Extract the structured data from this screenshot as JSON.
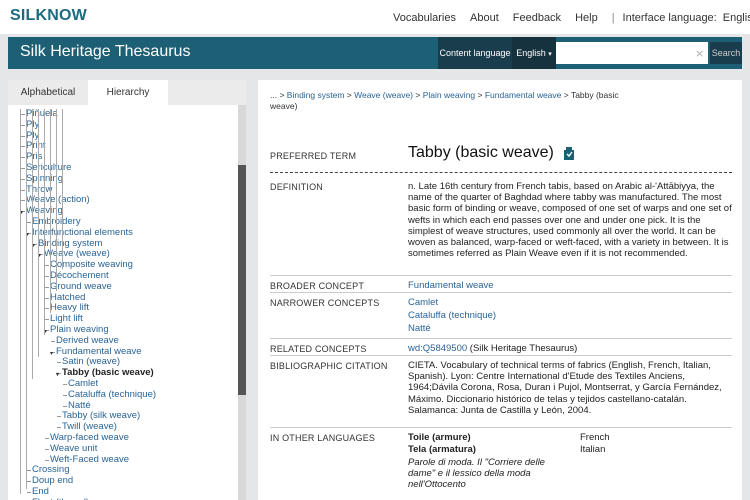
{
  "topnav": {
    "logo": "SILKNOW",
    "links": [
      "Vocabularies",
      "About",
      "Feedback",
      "Help"
    ],
    "interface_language_label": "Interface language:",
    "interface_language_value": "English"
  },
  "header": {
    "title": "Silk Heritage Thesaurus",
    "content_language_label": "Content language",
    "content_language_value": "English",
    "search_placeholder": "",
    "search_button": "Search"
  },
  "tabs": [
    "Alphabetical",
    "Hierarchy"
  ],
  "tree": [
    {
      "label": "Piñuela",
      "level": 2
    },
    {
      "label": "Ply",
      "level": 2
    },
    {
      "label": "Ply",
      "level": 2
    },
    {
      "label": "Print",
      "level": 2
    },
    {
      "label": "Pris",
      "level": 2
    },
    {
      "label": "Sericulture",
      "level": 2
    },
    {
      "label": "Spinning",
      "level": 2
    },
    {
      "label": "Throw",
      "level": 2
    },
    {
      "label": "Weave (action)",
      "level": 2
    },
    {
      "label": "Weaving",
      "level": 2,
      "expanded": true
    },
    {
      "label": "Embroidery",
      "level": 3
    },
    {
      "label": "Interfunctional elements",
      "level": 3,
      "expanded": true
    },
    {
      "label": "Binding system",
      "level": 4,
      "expanded": true
    },
    {
      "label": "Weave (weave)",
      "level": 5,
      "expanded": true
    },
    {
      "label": "Composite weaving",
      "level": 6
    },
    {
      "label": "Décochement",
      "level": 6
    },
    {
      "label": "Ground weave",
      "level": 6
    },
    {
      "label": "Hatched",
      "level": 6
    },
    {
      "label": "Heavy lift",
      "level": 6
    },
    {
      "label": "Light lift",
      "level": 6
    },
    {
      "label": "Plain weaving",
      "level": 6,
      "expanded": true
    },
    {
      "label": "Derived weave",
      "level": 7
    },
    {
      "label": "Fundamental weave",
      "level": 7,
      "expanded": true
    },
    {
      "label": "Satin (weave)",
      "level": 8
    },
    {
      "label": "Tabby (basic weave)",
      "level": 8,
      "expanded": true,
      "selected": true
    },
    {
      "label": "Camlet",
      "level": 9
    },
    {
      "label": "Cataluffa (technique)",
      "level": 9
    },
    {
      "label": "Natté",
      "level": 9
    },
    {
      "label": "Tabby (silk weave)",
      "level": 8
    },
    {
      "label": "Twill (weave)",
      "level": 8
    },
    {
      "label": "Warp-faced weave",
      "level": 6
    },
    {
      "label": "Weave unit",
      "level": 6
    },
    {
      "label": "Weft-Faced weave",
      "level": 6
    },
    {
      "label": "Crossing",
      "level": 3
    },
    {
      "label": "Doup end",
      "level": 3
    },
    {
      "label": "End",
      "level": 3
    },
    {
      "label": "Float (thread)",
      "level": 3
    }
  ],
  "breadcrumb": {
    "prefix": "... > ",
    "links": [
      "Binding system",
      "Weave (weave)",
      "Plain weaving",
      "Fundamental weave"
    ],
    "current": "Tabby (basic weave)"
  },
  "concept": {
    "preferred_term_label": "PREFERRED TERM",
    "preferred_term": "Tabby (basic weave)",
    "definition_label": "DEFINITION",
    "definition": "n. Late 16th century from French tabis, based on Arabic al-'Attābiyya, the name of the quarter of Baghdad where tabby was manufactured. The most basic form of binding or weave, composed of one set of warps and one set of wefts in which each end passes over one and under one pick. It is the simplest of weave structures, used commonly all over the world. It can be woven as balanced, warp-faced or weft-faced, with a variety in between. It is sometimes referred as Plain Weave even if it is not recommended.",
    "broader_label": "BROADER CONCEPT",
    "broader": "Fundamental weave",
    "narrower_label": "NARROWER CONCEPTS",
    "narrower": [
      "Camlet",
      "Cataluffa (technique)",
      "Natté"
    ],
    "related_label": "RELATED CONCEPTS",
    "related_link": "wd:Q5849500",
    "related_suffix": " (Silk Heritage Thesaurus)",
    "citation_label": "BIBLIOGRAPHIC CITATION",
    "citation": "CIETA. Vocabulary of technical terms of fabrics (English, French, Italian, Spanish). Lyon: Centre International d'Etude des Textiles Anciens, 1964;Dávila Corona, Rosa, Duran i Pujol, Montserrat, y García Fernández, Máximo. Diccionario histórico de telas y tejidos castellano-catalán. Salamanca: Junta de Castilla y León, 2004.",
    "other_lang_label": "IN OTHER LANGUAGES",
    "other_languages": [
      {
        "term": "Toile (armure)",
        "language": "French"
      },
      {
        "term": "Tela (armatura)",
        "language": "Italian"
      }
    ],
    "other_lang_note": "Parole di moda. Il \"Corriere delle dame\" e il lessico della moda nell'Ottocento"
  },
  "colors": {
    "header_bg": "#1d5f75",
    "logo": "#1c6b7e",
    "link": "#2a6496"
  }
}
